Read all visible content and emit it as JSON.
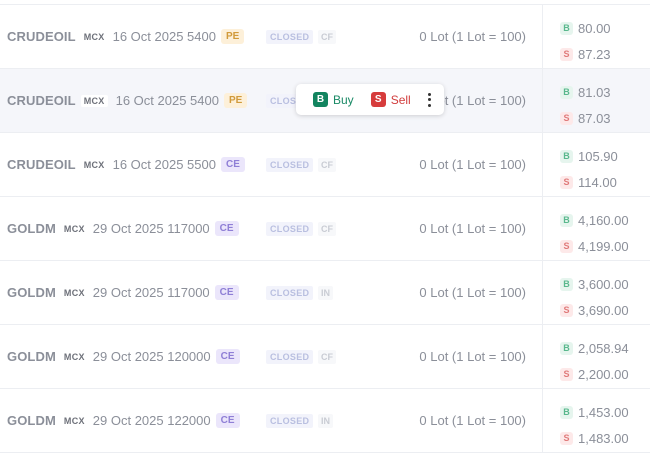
{
  "rows": [
    {
      "symbol": "CRUDEOIL",
      "exchange": "MCX",
      "expiry": "16 Oct 2025 5400",
      "opt_type": "PE",
      "status": "CLOSED",
      "tag": "CF",
      "lots": "0 Lot (1 Lot = 100)",
      "buy_price": "80.00",
      "sell_price": "87.23",
      "buy_icon": "B",
      "sell_icon": "S"
    },
    {
      "symbol": "CRUDEOIL",
      "exchange": "MCX",
      "expiry": "16 Oct 2025 5400",
      "opt_type": "PE",
      "status": "CLOS",
      "tag": "",
      "lots": "ot (1 Lot = 100)",
      "buy_price": "81.03",
      "sell_price": "87.03",
      "buy_icon": "B",
      "sell_icon": "S"
    },
    {
      "symbol": "CRUDEOIL",
      "exchange": "MCX",
      "expiry": "16 Oct 2025 5500",
      "opt_type": "CE",
      "status": "CLOSED",
      "tag": "CF",
      "lots": "0 Lot (1 Lot = 100)",
      "buy_price": "105.90",
      "sell_price": "114.00",
      "buy_icon": "B",
      "sell_icon": "S"
    },
    {
      "symbol": "GOLDM",
      "exchange": "MCX",
      "expiry": "29 Oct 2025 117000",
      "opt_type": "CE",
      "status": "CLOSED",
      "tag": "CF",
      "lots": "0 Lot (1 Lot = 100)",
      "buy_price": "4,160.00",
      "sell_price": "4,199.00",
      "buy_icon": "B",
      "sell_icon": "S"
    },
    {
      "symbol": "GOLDM",
      "exchange": "MCX",
      "expiry": "29 Oct 2025 117000",
      "opt_type": "CE",
      "status": "CLOSED",
      "tag": "IN",
      "lots": "0 Lot (1 Lot = 100)",
      "buy_price": "3,600.00",
      "sell_price": "3,690.00",
      "buy_icon": "B",
      "sell_icon": "S"
    },
    {
      "symbol": "GOLDM",
      "exchange": "MCX",
      "expiry": "29 Oct 2025 120000",
      "opt_type": "CE",
      "status": "CLOSED",
      "tag": "CF",
      "lots": "0 Lot (1 Lot = 100)",
      "buy_price": "2,058.94",
      "sell_price": "2,200.00",
      "buy_icon": "B",
      "sell_icon": "S"
    },
    {
      "symbol": "GOLDM",
      "exchange": "MCX",
      "expiry": "29 Oct 2025 122000",
      "opt_type": "CE",
      "status": "CLOSED",
      "tag": "IN",
      "lots": "0 Lot (1 Lot = 100)",
      "buy_price": "1,453.00",
      "sell_price": "1,483.00",
      "buy_icon": "B",
      "sell_icon": "S"
    }
  ],
  "action_bar": {
    "buy_icon": "B",
    "buy_label": "Buy",
    "sell_icon": "S",
    "sell_label": "Sell",
    "more_icon": "more-vertical-icon"
  },
  "colors": {
    "buy": "#12845f",
    "sell": "#d63c3c",
    "pe_badge": "#fdf0d9",
    "ce_badge": "#ebe6fb"
  }
}
